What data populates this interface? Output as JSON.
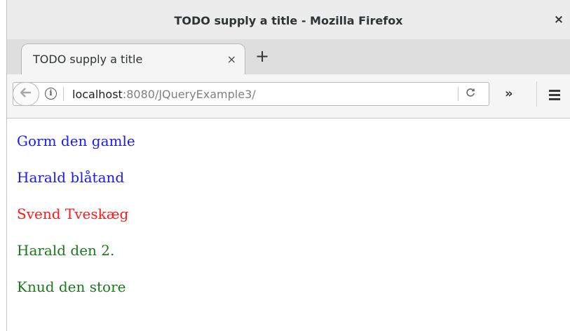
{
  "window": {
    "title": "TODO supply a title - Mozilla Firefox",
    "close_glyph": "×"
  },
  "tabs": [
    {
      "label": "TODO supply a title",
      "close_glyph": "×"
    }
  ],
  "new_tab_glyph": "+",
  "nav": {
    "back_icon": "back-arrow-icon",
    "url_host": "localhost",
    "url_rest": ":8080/JQueryExample3/",
    "reload_glyph": "C",
    "overflow_glyph": "»",
    "menu_icon": "hamburger-menu-icon"
  },
  "content": {
    "items": [
      {
        "text": "Gorm den gamle",
        "color": "#1a1aff"
      },
      {
        "text": "Harald blåtand",
        "color": "#1a1aff"
      },
      {
        "text": "Svend Tveskæg",
        "color": "#ff1a1a"
      },
      {
        "text": "Harald den 2.",
        "color": "#1a7a1a"
      },
      {
        "text": "Knud den store",
        "color": "#1a7a1a"
      }
    ]
  }
}
